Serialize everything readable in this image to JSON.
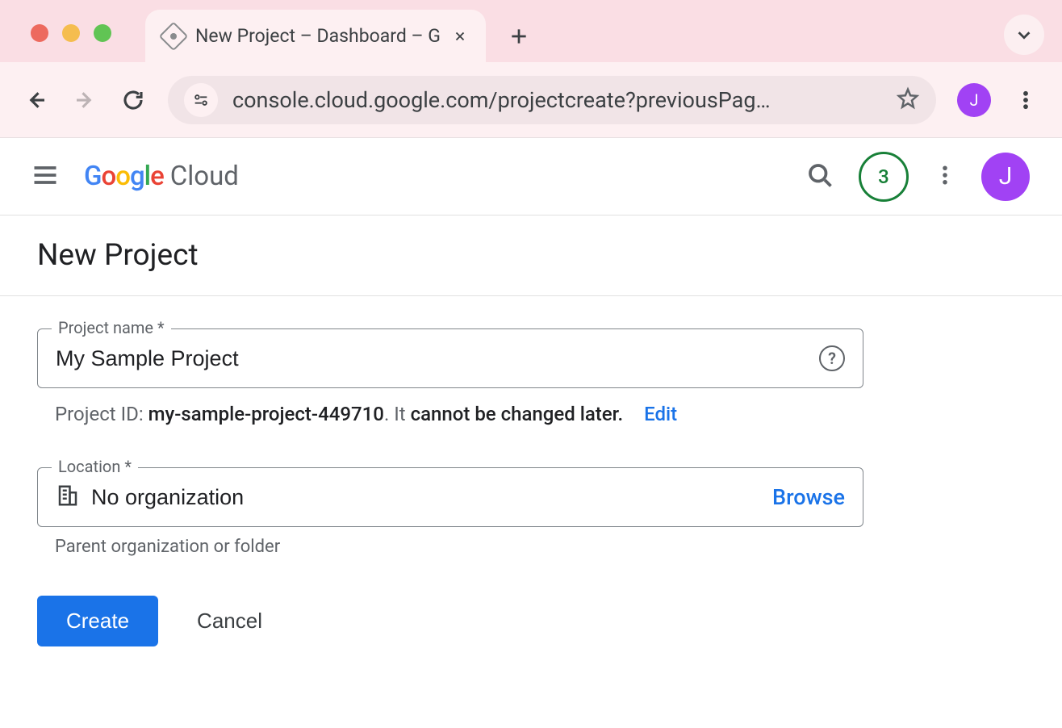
{
  "browser": {
    "tab_title": "New Project – Dashboard – G",
    "url": "console.cloud.google.com/projectcreate?previousPag…",
    "profile_initial": "J"
  },
  "cloud_header": {
    "logo_google": "Google",
    "logo_cloud": "Cloud",
    "notif_count": "3",
    "avatar_initial": "J"
  },
  "page": {
    "title": "New Project"
  },
  "project_name": {
    "label": "Project name *",
    "value": "My Sample Project"
  },
  "project_id": {
    "prefix": "Project ID: ",
    "id": "my-sample-project-449710",
    "suffix1": ". It ",
    "bold": "cannot be changed later.",
    "edit_label": "Edit"
  },
  "location": {
    "label": "Location *",
    "value": "No organization",
    "browse_label": "Browse",
    "helper": "Parent organization or folder"
  },
  "buttons": {
    "create": "Create",
    "cancel": "Cancel"
  }
}
